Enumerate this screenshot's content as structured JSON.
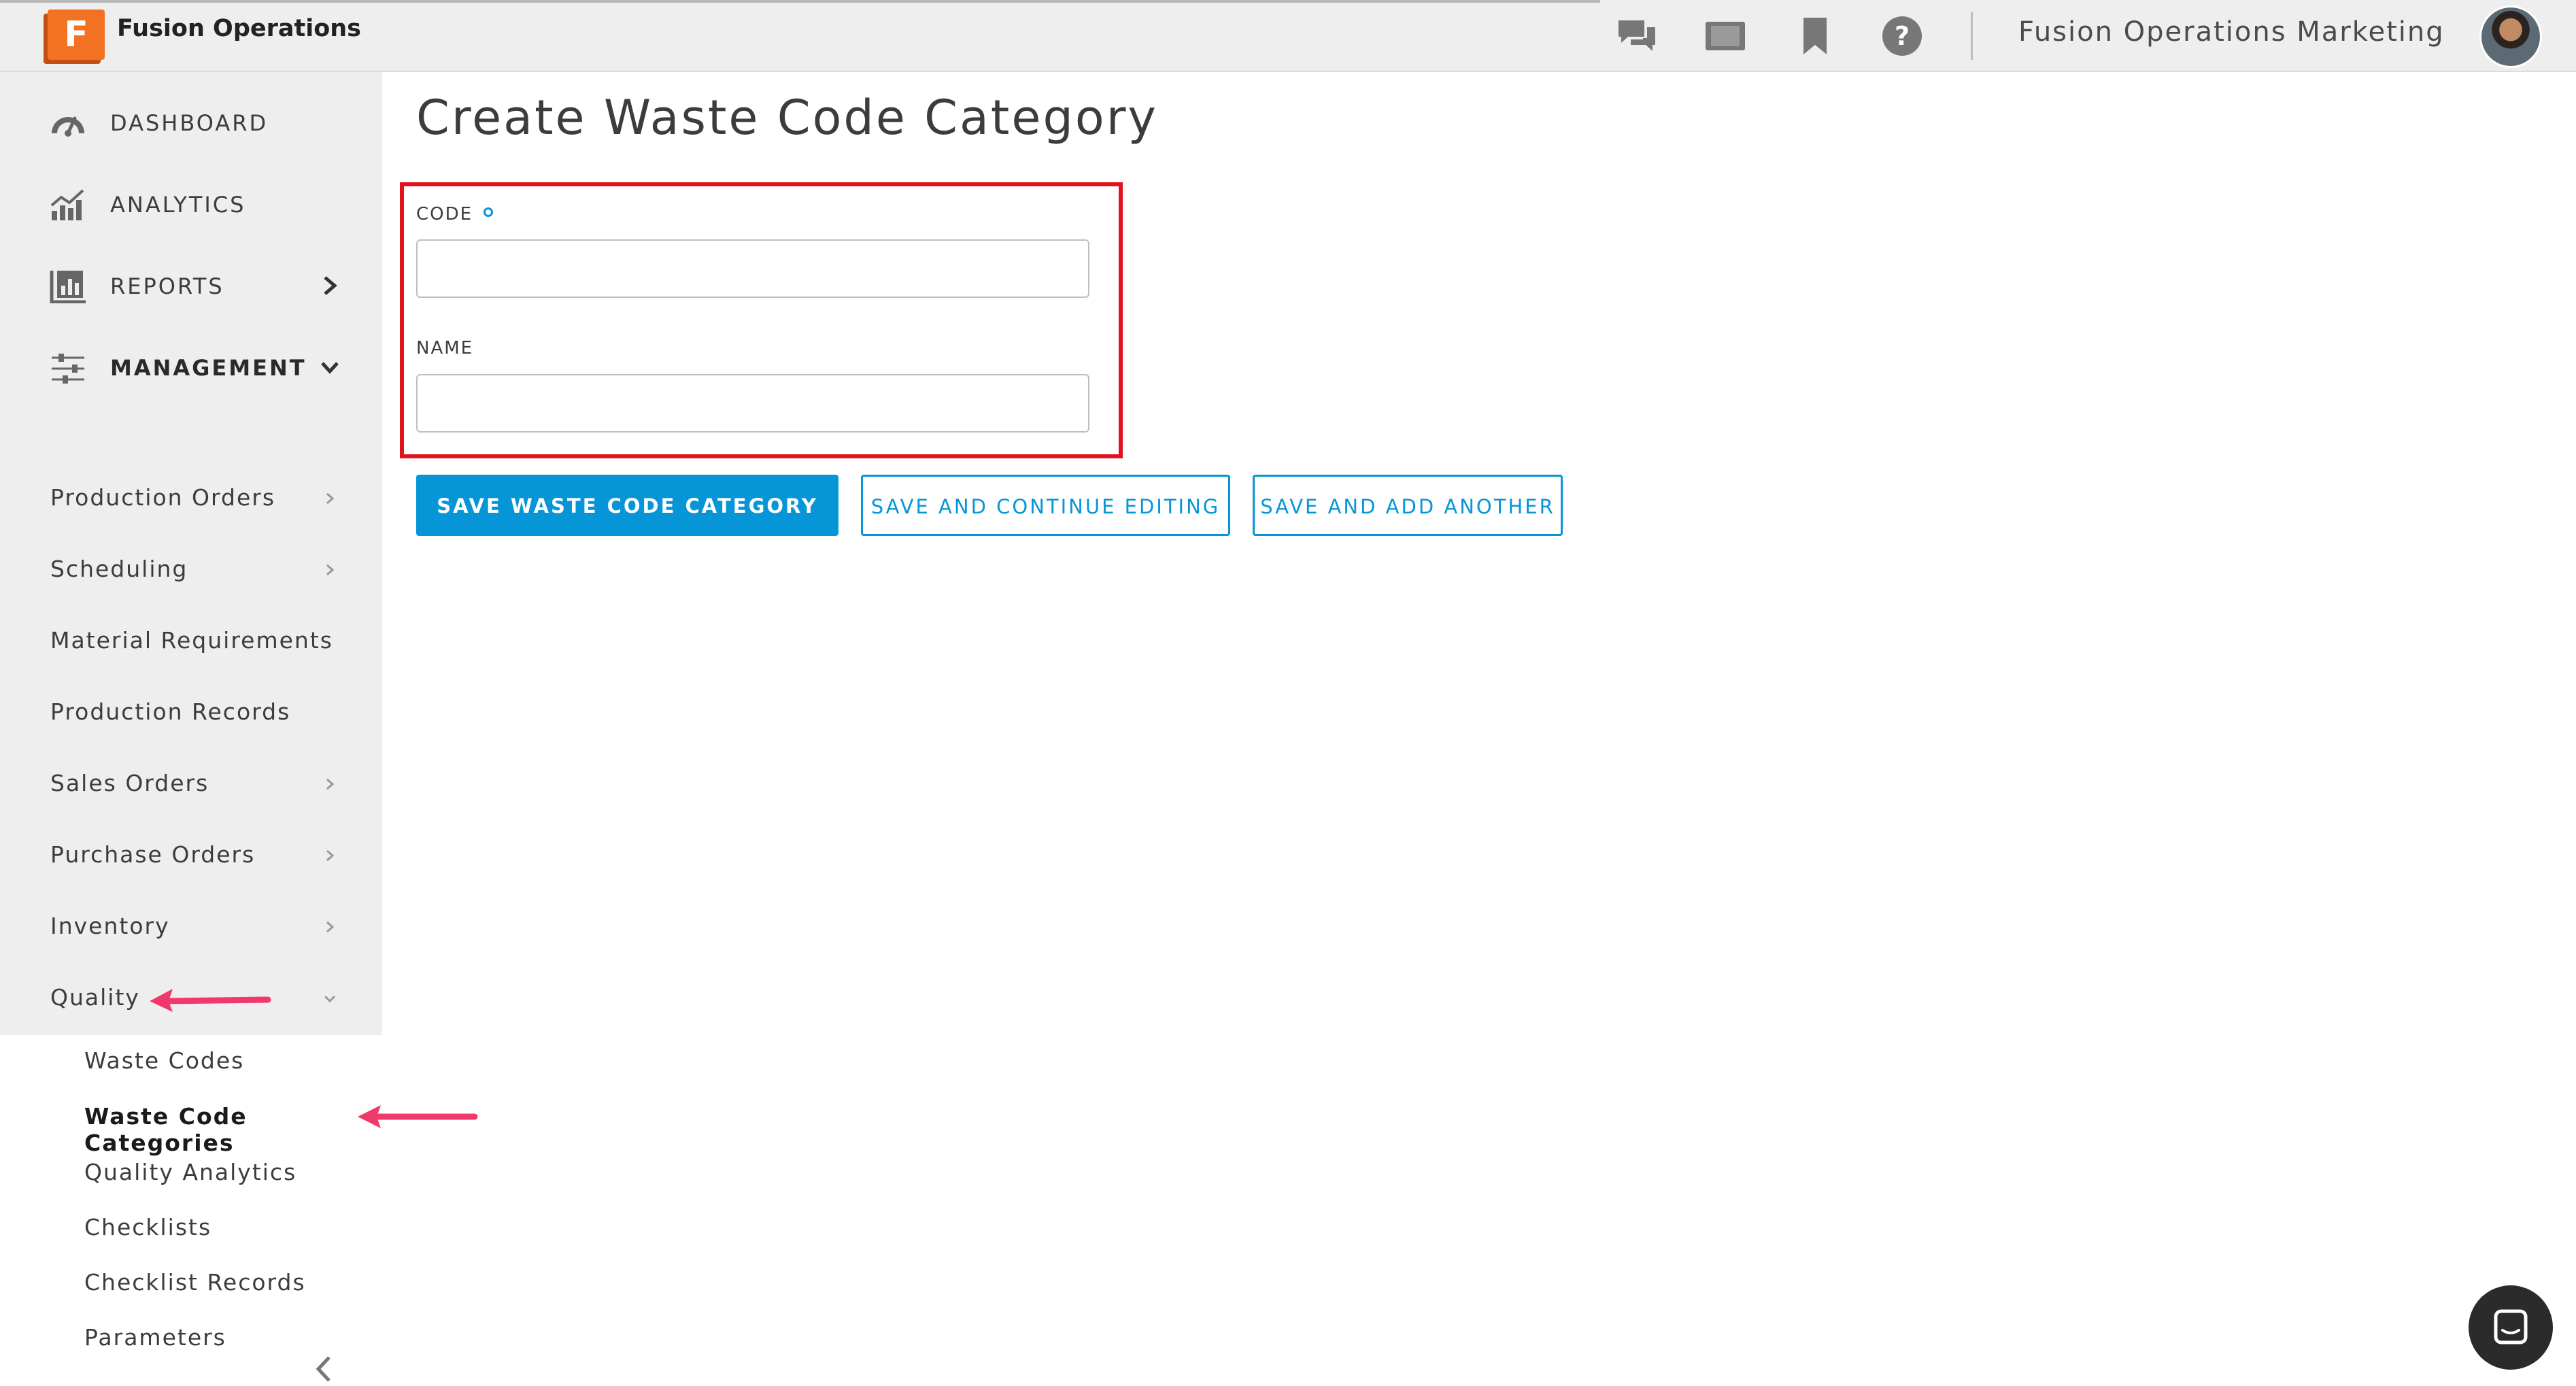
{
  "app": {
    "name": "Fusion Operations",
    "logo_letter": "F",
    "org_name": "Fusion Operations Marketing"
  },
  "topbar_icons": [
    "chat-icon",
    "tablet-icon",
    "bookmark-icon",
    "help-icon"
  ],
  "sidebar": {
    "main_items": [
      {
        "label": "DASHBOARD",
        "icon": "dashboard-gauge-icon"
      },
      {
        "label": "ANALYTICS",
        "icon": "analytics-chart-icon"
      },
      {
        "label": "REPORTS",
        "icon": "reports-bar-icon",
        "chevron": "right"
      },
      {
        "label": "MANAGEMENT",
        "icon": "management-sliders-icon",
        "chevron": "down",
        "expanded": true
      }
    ],
    "management_items": [
      {
        "label": "Production Orders",
        "chevron": "right"
      },
      {
        "label": "Scheduling",
        "chevron": "right"
      },
      {
        "label": "Material Requirements"
      },
      {
        "label": "Production Records"
      },
      {
        "label": "Sales Orders",
        "chevron": "right"
      },
      {
        "label": "Purchase Orders",
        "chevron": "right"
      },
      {
        "label": "Inventory",
        "chevron": "right"
      },
      {
        "label": "Quality",
        "chevron": "down",
        "expanded": true
      }
    ],
    "quality_items": [
      {
        "label": "Waste Codes"
      },
      {
        "label": "Waste Code Categories",
        "active": true
      },
      {
        "label": "Quality Analytics"
      },
      {
        "label": "Checklists"
      },
      {
        "label": "Checklist Records"
      },
      {
        "label": "Parameters"
      }
    ]
  },
  "form": {
    "title": "Create Waste Code Category",
    "code_label": "CODE",
    "code_required": true,
    "code_value": "",
    "name_label": "NAME",
    "name_value": ""
  },
  "buttons": {
    "save": "SAVE WASTE CODE CATEGORY",
    "save_continue": "SAVE AND CONTINUE EDITING",
    "save_another": "SAVE AND ADD ANOTHER"
  },
  "colors": {
    "accent": "#0696d7",
    "highlight_box": "#e0141e",
    "annotation_arrow": "#f0386b",
    "logo_orange": "#f37123"
  }
}
